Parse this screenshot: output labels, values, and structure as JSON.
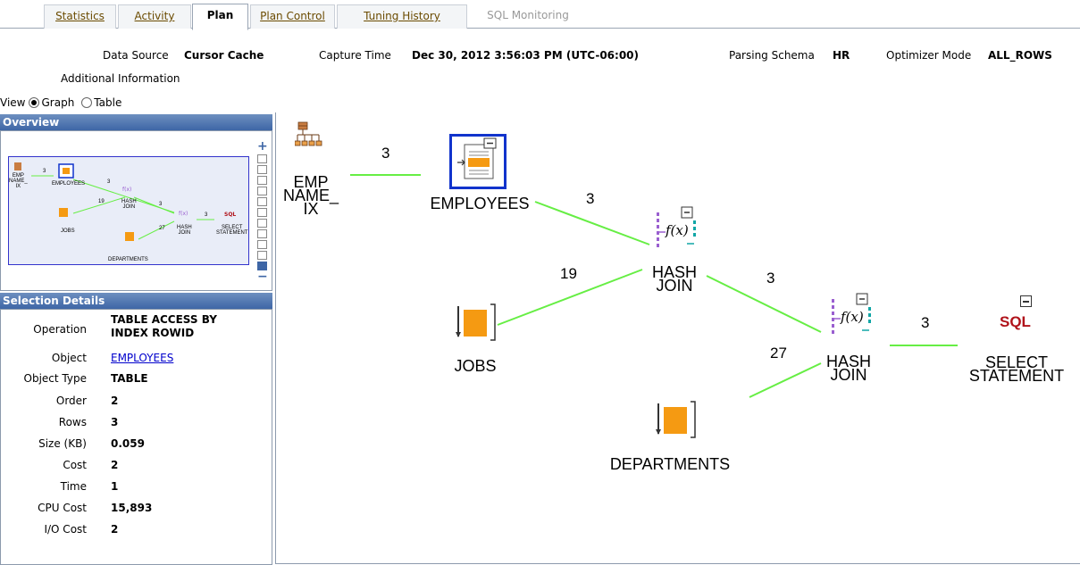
{
  "tabs": [
    {
      "label": "Statistics",
      "state": "normal"
    },
    {
      "label": "Activity",
      "state": "normal"
    },
    {
      "label": "Plan",
      "state": "selected"
    },
    {
      "label": "Plan Control",
      "state": "normal"
    },
    {
      "label": "Tuning History",
      "state": "normal"
    },
    {
      "label": "SQL Monitoring",
      "state": "disabled"
    }
  ],
  "header": {
    "data_source_label": "Data Source",
    "data_source_value": "Cursor Cache",
    "capture_time_label": "Capture Time",
    "capture_time_value": "Dec 30, 2012 3:56:03 PM (UTC-06:00)",
    "parsing_schema_label": "Parsing Schema",
    "parsing_schema_value": "HR",
    "optimizer_mode_label": "Optimizer Mode",
    "optimizer_mode_value": "ALL_ROWS",
    "additional_info": "Additional Information"
  },
  "view": {
    "label": "View",
    "options": [
      "Graph",
      "Table"
    ],
    "selected": "Graph"
  },
  "overview": {
    "title": "Overview",
    "plus": "+",
    "minus": "−",
    "labels": {
      "emp_name_ix": "EMP\nNAME_\nIX",
      "employees": "EMPLOYEES",
      "jobs": "JOBS",
      "departments": "DEPARTMENTS",
      "hash_join_1": "HASH\nJOIN",
      "hash_join_2": "HASH\nJOIN",
      "select_statement": "SELECT\nSTATEMENT",
      "sql": "SQL",
      "e1": "3",
      "e2": "3",
      "e3": "19",
      "e4": "3",
      "e5": "27",
      "e6": "3"
    }
  },
  "selection": {
    "title": "Selection Details",
    "rows": [
      {
        "label": "Operation",
        "value": "TABLE ACCESS BY\nINDEX ROWID"
      },
      {
        "label": "Object",
        "value": "EMPLOYEES"
      },
      {
        "label": "Object Type",
        "value": "TABLE"
      },
      {
        "label": "Order",
        "value": "2"
      },
      {
        "label": "Rows",
        "value": "3"
      },
      {
        "label": "Size (KB)",
        "value": "0.059"
      },
      {
        "label": "Cost",
        "value": "2"
      },
      {
        "label": "Time",
        "value": "1"
      },
      {
        "label": "CPU Cost",
        "value": "15,893"
      },
      {
        "label": "I/O Cost",
        "value": "2"
      }
    ]
  },
  "graph": {
    "nodes": {
      "emp_name_ix": "EMP\nNAME_\nIX",
      "employees": "EMPLOYEES",
      "jobs": "JOBS",
      "departments": "DEPARTMENTS",
      "hash_join_1": "HASH\nJOIN",
      "hash_join_2": "HASH\nJOIN",
      "select_statement": "SELECT\nSTATEMENT"
    },
    "edge_labels": {
      "emp_to_employees": "3",
      "employees_to_hash1": "3",
      "jobs_to_hash1": "19",
      "hash1_to_hash2": "3",
      "departments_to_hash2": "27",
      "hash2_to_select": "3"
    },
    "sql_badge": "SQL",
    "fx": "f(x)",
    "collapse": "−"
  },
  "colors": {
    "edge": "#66ee44",
    "panel_header": "#3e66a6",
    "table_orange": "#f59a12",
    "sql_red": "#b0121a",
    "link": "#0000cc",
    "fx_purple": "#9a5fd0",
    "fx_teal": "#11a6a6"
  }
}
